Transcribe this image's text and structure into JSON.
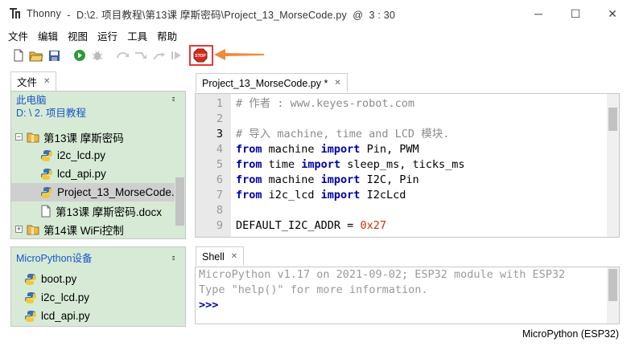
{
  "window": {
    "app_name": "Thonny",
    "title_rest": "  -  D:\\2. 项目教程\\第13课 摩斯密码\\Project_13_MorseCode.py  @  3 : 30",
    "minimize": "─",
    "maximize": "☐",
    "close": "✕"
  },
  "menu": [
    "文件",
    "编辑",
    "视图",
    "运行",
    "工具",
    "帮助"
  ],
  "toolbar": {
    "stop_label": "STOP",
    "icons": [
      "new-file-icon",
      "open-folder-icon",
      "save-icon",
      "run-icon",
      "debug-icon",
      "step-over-icon",
      "step-into-icon",
      "step-out-icon",
      "resume-icon",
      "stop-icon"
    ],
    "highlight_color": "#e53935",
    "arrow_color": "#f08a3c"
  },
  "files": {
    "tab_label": "文件",
    "section1_title": "此电脑",
    "section1_path": "D: \\ 2. 项目教程",
    "tree": [
      {
        "label": "第13课 摩斯密码",
        "type": "folder",
        "expander": "−",
        "indent": 0
      },
      {
        "label": "i2c_lcd.py",
        "type": "py",
        "indent": 1
      },
      {
        "label": "lcd_api.py",
        "type": "py",
        "indent": 1
      },
      {
        "label": "Project_13_MorseCode.",
        "type": "py",
        "indent": 1,
        "selected": true
      },
      {
        "label": "第13课 摩斯密码.docx",
        "type": "doc",
        "indent": 1
      },
      {
        "label": "第14课 WiFi控制",
        "type": "folder",
        "expander": "+",
        "indent": 0
      }
    ],
    "section2_title": "MicroPython设备",
    "device_files": [
      "boot.py",
      "i2c_lcd.py",
      "lcd_api.py"
    ],
    "menu_glyph": "≡"
  },
  "editor": {
    "tab_label": "Project_13_MorseCode.py *",
    "current_line": 3,
    "lines": [
      {
        "n": "1",
        "parts": [
          [
            "cm",
            "# 作者 : www.keyes-robot.com"
          ]
        ]
      },
      {
        "n": "2",
        "parts": []
      },
      {
        "n": "3",
        "parts": [
          [
            "cm",
            "# 导入 machine, time and LCD 模块."
          ]
        ]
      },
      {
        "n": "4",
        "parts": [
          [
            "kw",
            "from"
          ],
          [
            "",
            " machine "
          ],
          [
            "kw",
            "import"
          ],
          [
            "",
            " Pin, PWM"
          ]
        ]
      },
      {
        "n": "5",
        "parts": [
          [
            "kw",
            "from"
          ],
          [
            "",
            " time "
          ],
          [
            "kw",
            "import"
          ],
          [
            "",
            " sleep_ms, ticks_ms"
          ]
        ]
      },
      {
        "n": "6",
        "parts": [
          [
            "kw",
            "from"
          ],
          [
            "",
            " machine "
          ],
          [
            "kw",
            "import"
          ],
          [
            "",
            " I2C, Pin"
          ]
        ]
      },
      {
        "n": "7",
        "parts": [
          [
            "kw",
            "from"
          ],
          [
            "",
            " i2c_lcd "
          ],
          [
            "kw",
            "import"
          ],
          [
            "",
            " I2cLcd"
          ]
        ]
      },
      {
        "n": "8",
        "parts": []
      },
      {
        "n": "9",
        "parts": [
          [
            "",
            "DEFAULT_I2C_ADDR = "
          ],
          [
            "num",
            "0x27"
          ]
        ]
      }
    ]
  },
  "shell": {
    "tab_label": "Shell",
    "lines": [
      "MicroPython v1.17 on 2021-09-02; ESP32 module with ESP32",
      "Type \"help()\" for more information."
    ],
    "prompt": ">>>"
  },
  "status": {
    "interpreter": "MicroPython (ESP32)"
  }
}
